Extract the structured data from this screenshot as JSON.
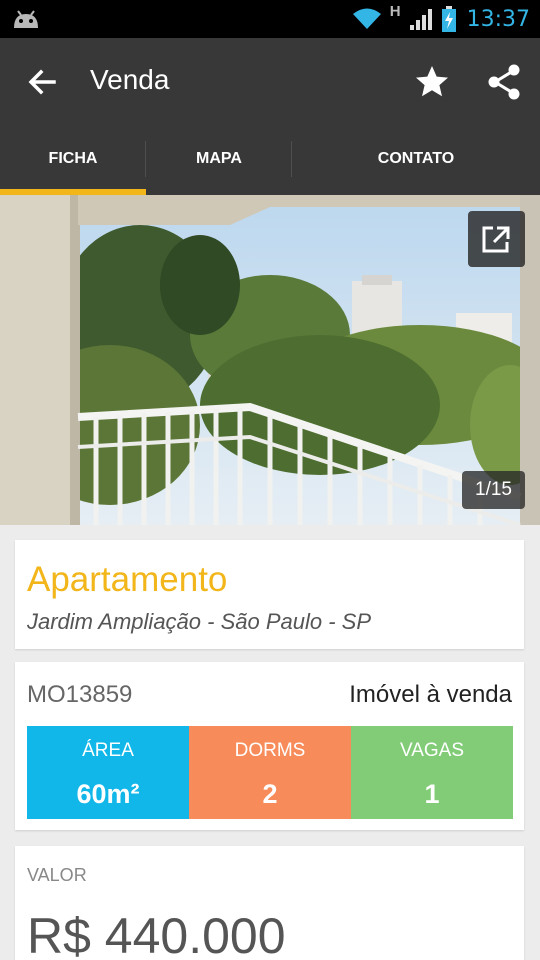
{
  "status_bar": {
    "time": "13:37",
    "network_type": "H",
    "icons": [
      "android-icon",
      "wifi-icon",
      "signal-icon",
      "battery-icon"
    ]
  },
  "action_bar": {
    "title": "Venda",
    "icons": [
      "back-arrow-icon",
      "star-icon",
      "share-icon"
    ]
  },
  "tabs": [
    {
      "label": "FICHA",
      "selected": true
    },
    {
      "label": "MAPA",
      "selected": false
    },
    {
      "label": "CONTATO",
      "selected": false
    }
  ],
  "gallery": {
    "counter": "1/15",
    "icons": [
      "open-external-icon"
    ]
  },
  "property": {
    "type": "Apartamento",
    "location": "Jardim Ampliação - São Paulo - SP"
  },
  "listing": {
    "code": "MO13859",
    "status": "Imóvel à venda",
    "stats": [
      {
        "label": "ÁREA",
        "value": "60m²",
        "color": "#10b7e8"
      },
      {
        "label": "DORMS",
        "value": "2",
        "color": "#f78c5a"
      },
      {
        "label": "VAGAS",
        "value": "1",
        "color": "#82cc78"
      }
    ]
  },
  "price": {
    "label": "VALOR",
    "value": "R$ 440.000"
  },
  "colors": {
    "accent": "#f2b51a",
    "action_bar": "#383838",
    "status_time": "#33b5e5"
  }
}
